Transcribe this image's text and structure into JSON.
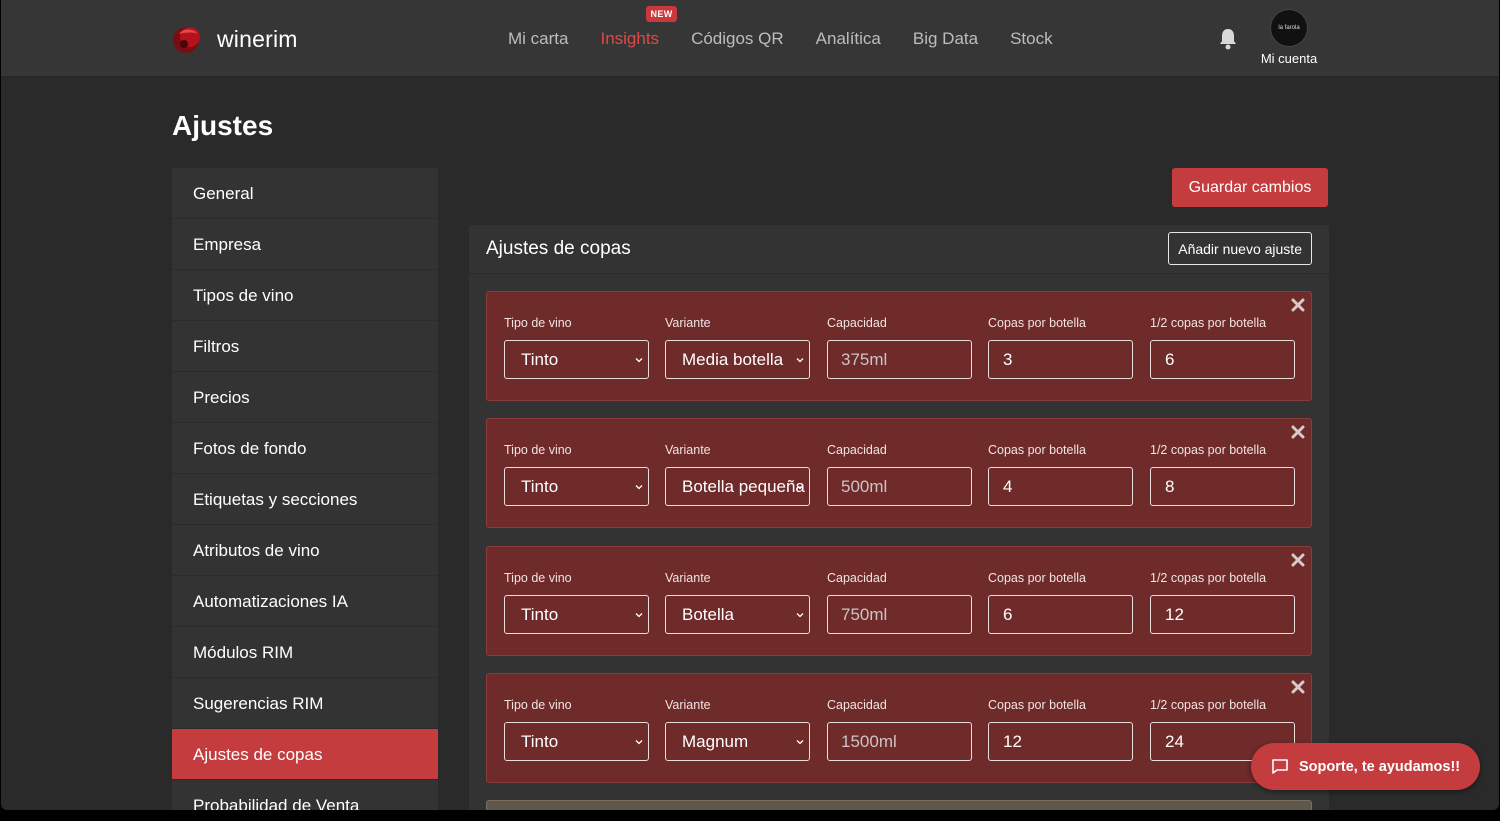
{
  "app": {
    "brand": "winerim"
  },
  "nav": {
    "items": [
      {
        "label": "Mi carta",
        "active": false
      },
      {
        "label": "Insights",
        "active": true,
        "badge": "NEW"
      },
      {
        "label": "Códigos QR",
        "active": false
      },
      {
        "label": "Analítica",
        "active": false
      },
      {
        "label": "Big Data",
        "active": false
      },
      {
        "label": "Stock",
        "active": false
      }
    ],
    "account_label": "Mi cuenta",
    "avatar_text": "la farola"
  },
  "page": {
    "title": "Ajustes"
  },
  "sidebar": {
    "items": [
      {
        "label": "General"
      },
      {
        "label": "Empresa"
      },
      {
        "label": "Tipos de vino"
      },
      {
        "label": "Filtros"
      },
      {
        "label": "Precios"
      },
      {
        "label": "Fotos de fondo"
      },
      {
        "label": "Etiquetas y secciones"
      },
      {
        "label": "Atributos de vino"
      },
      {
        "label": "Automatizaciones IA"
      },
      {
        "label": "Módulos RIM"
      },
      {
        "label": "Sugerencias RIM"
      },
      {
        "label": "Ajustes de copas",
        "active": true
      },
      {
        "label": "Probabilidad de Venta"
      }
    ]
  },
  "actions": {
    "save_label": "Guardar cambios"
  },
  "panel": {
    "title": "Ajustes de copas",
    "add_label": "Añadir nuevo ajuste",
    "labels": {
      "wine_type": "Tipo de vino",
      "variant": "Variante",
      "capacity": "Capacidad",
      "glasses": "Copas por botella",
      "half_glasses": "1/2 copas por botella"
    },
    "rows": [
      {
        "wine_type": "Tinto",
        "variant": "Media botella",
        "capacity": "375ml",
        "glasses": "3",
        "half_glasses": "6"
      },
      {
        "wine_type": "Tinto",
        "variant": "Botella pequeña",
        "capacity": "500ml",
        "glasses": "4",
        "half_glasses": "8"
      },
      {
        "wine_type": "Tinto",
        "variant": "Botella",
        "capacity": "750ml",
        "glasses": "6",
        "half_glasses": "12"
      },
      {
        "wine_type": "Tinto",
        "variant": "Magnum",
        "capacity": "1500ml",
        "glasses": "12",
        "half_glasses": "24"
      }
    ]
  },
  "support": {
    "label": "Soporte, te ayudamos!!"
  },
  "colors": {
    "accent": "#c43c3e",
    "card": "#6f2a2a",
    "background": "#2a2a2a"
  }
}
